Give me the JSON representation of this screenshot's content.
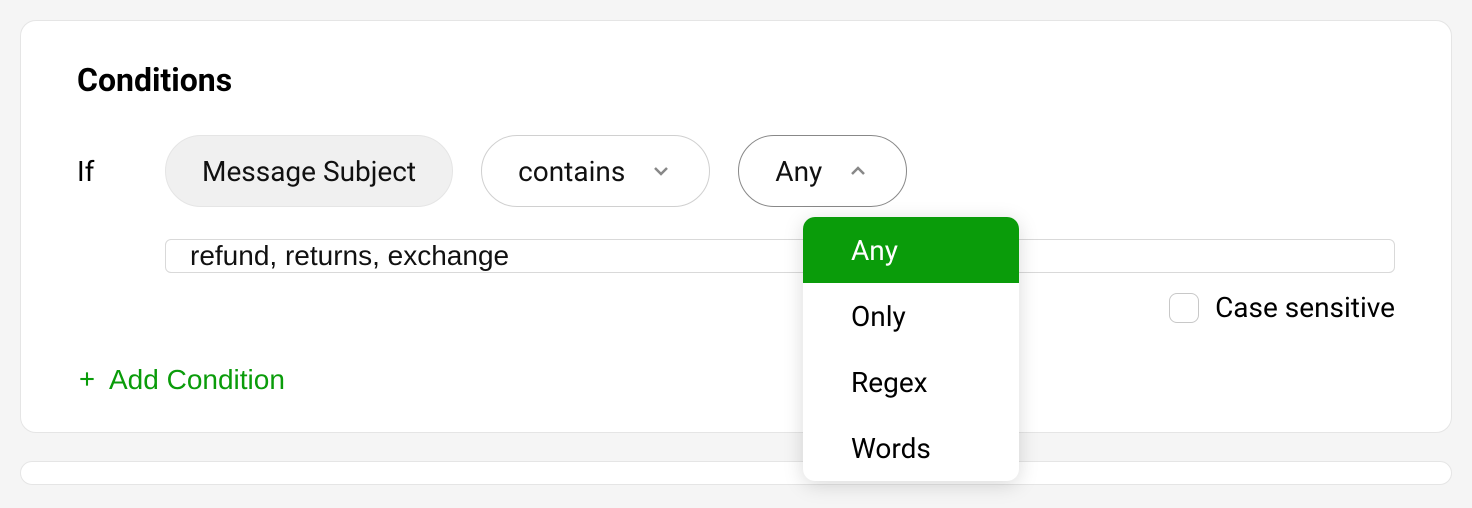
{
  "section": {
    "title": "Conditions",
    "ifLabel": "If",
    "addConditionLabel": "Add Condition"
  },
  "condition": {
    "fieldLabel": "Message Subject",
    "operatorLabel": "contains",
    "matchModeLabel": "Any",
    "value": "refund, returns, exchange",
    "caseSensitiveLabel": "Case sensitive",
    "caseSensitiveChecked": false
  },
  "matchModeDropdown": {
    "open": true,
    "selected": "Any",
    "options": [
      "Any",
      "Only",
      "Regex",
      "Words"
    ]
  }
}
